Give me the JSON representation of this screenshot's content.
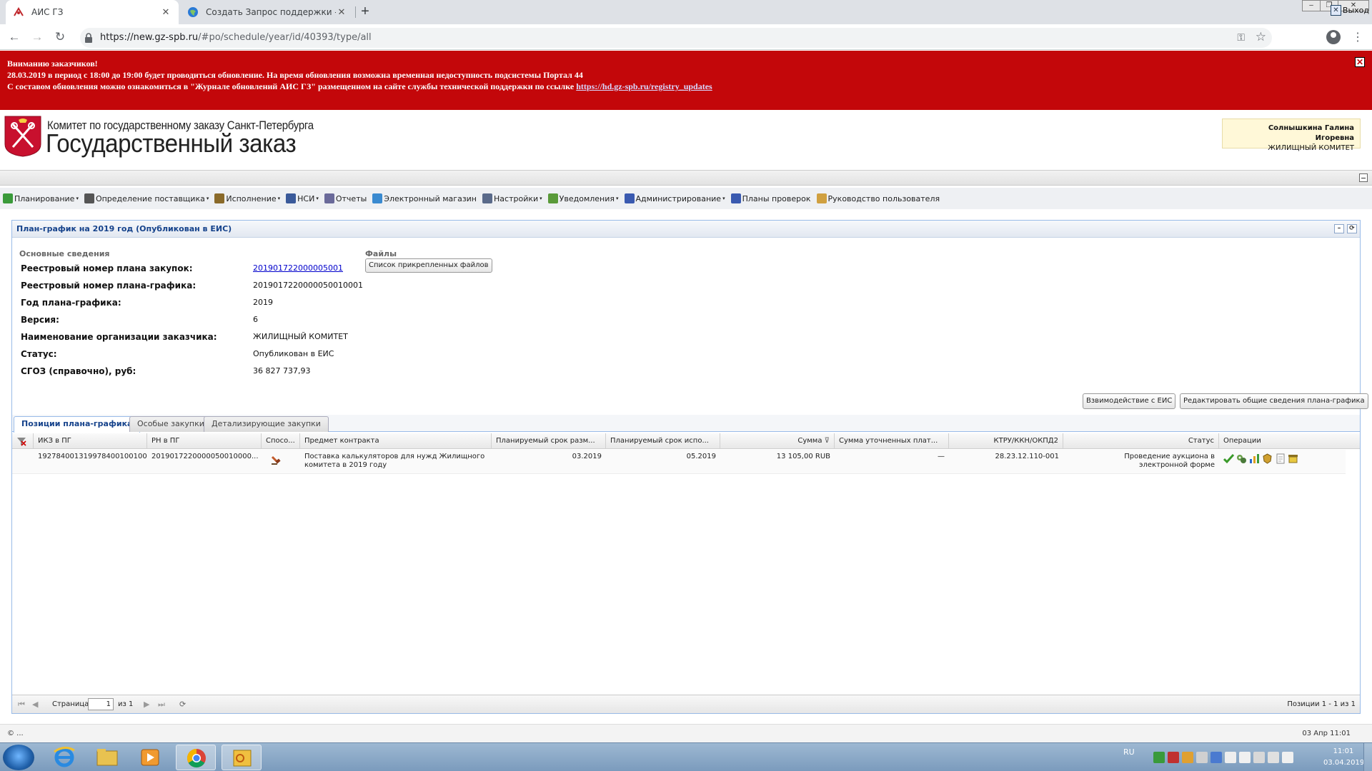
{
  "browser": {
    "tabs": [
      {
        "title": "АИС ГЗ",
        "icon": "gz-tab-icon"
      },
      {
        "title": "Создать Запрос поддержки - АИС",
        "icon": "globe-icon"
      }
    ],
    "url_host": "https://new.gz-spb.ru",
    "url_path": "/#po/schedule/year/id/40393/type/all"
  },
  "alert": {
    "line1": "Вниманию заказчиков!",
    "line2": "28.03.2019 в период с 18:00 до 19:00 будет проводиться обновление. На время обновления возможна временная недоступность подсистемы Портал 44",
    "line3": "С составом обновления можно ознакомиться в \"Журнале обновлений АИС ГЗ\" размещенном на сайте службы технической поддержки по ссылке",
    "link": "https://hd.gz-spb.ru/registry_updates"
  },
  "header": {
    "org": "Комитет по государственному заказу Санкт-Петербурга",
    "title": "Государственный заказ",
    "user_name": "Солнышкина Галина Игоревна",
    "user_org": "ЖИЛИЩНЫЙ КОМИТЕТ"
  },
  "menu": [
    {
      "label": "Планирование",
      "caret": "▾",
      "color": "#3a9a3a"
    },
    {
      "label": "Определение поставщика",
      "caret": "▾",
      "color": "#555555"
    },
    {
      "label": "Исполнение",
      "caret": "▾",
      "color": "#8a6a2a"
    },
    {
      "label": "НСИ",
      "caret": "▾",
      "color": "#3a5a9a"
    },
    {
      "label": "Отчеты",
      "caret": "",
      "color": "#6a6a9a"
    },
    {
      "label": "Электронный магазин",
      "caret": "",
      "color": "#3a8ad0"
    },
    {
      "label": "Настройки",
      "caret": "▾",
      "color": "#5a6a8a"
    },
    {
      "label": "Уведомления",
      "caret": "▾",
      "color": "#5a9a3a"
    },
    {
      "label": "Администрирование",
      "caret": "▾",
      "color": "#3a5ab0"
    },
    {
      "label": "Планы проверок",
      "caret": "",
      "color": "#3a5ab0"
    },
    {
      "label": "Руководство пользователя",
      "caret": "",
      "color": "#d0a040"
    }
  ],
  "exit_label": "Выход",
  "panel": {
    "title": "План-график на 2019 год (Опубликован в ЕИС)",
    "section": "Основные сведения",
    "files_label": "Файлы",
    "files_button": "Список прикрепленных файлов",
    "fields": [
      {
        "key": "Реестровый номер плана закупок:",
        "value": "201901722000005001",
        "link": true
      },
      {
        "key": "Реестровый номер плана-графика:",
        "value": "2019017220000050010001",
        "link": false
      },
      {
        "key": "Год плана-графика:",
        "value": "2019",
        "link": false
      },
      {
        "key": "Версия:",
        "value": "6",
        "link": false
      },
      {
        "key": "Наименование организации заказчика:",
        "value": "ЖИЛИЩНЫЙ КОМИТЕТ",
        "link": false
      },
      {
        "key": "Статус:",
        "value": "Опубликован в ЕИС",
        "link": false
      },
      {
        "key": "СГОЗ (справочно), руб:",
        "value": "36 827 737,93",
        "link": false
      }
    ],
    "btn_eis": "Взвимодействие с ЕИС",
    "btn_edit": "Редактировать общие сведения плана-графика",
    "tabs": [
      "Позиции плана-графика",
      "Особые закупки",
      "Детализирующие закупки"
    ]
  },
  "grid": {
    "columns": [
      "ИКЗ в ПГ",
      "РН в ПГ",
      "Спосо...",
      "Предмет контракта",
      "Планируемый срок разм...",
      "Планируемый срок испо...",
      "Сумма",
      "Сумма уточненных плат...",
      "КТРУ/ККН/ОКПД2",
      "Статус",
      "Операции"
    ],
    "rows": [
      {
        "ikz": "192784001319978400100100...",
        "rn": "2019017220000050010000...",
        "subject": "Поставка калькуляторов для нужд Жилищного комитета в 2019 году",
        "date_place": "03.2019",
        "date_exec": "05.2019",
        "sum": "13 105,00 RUB",
        "sum_refined": "—",
        "ktru": "28.23.12.110-001",
        "status": "Проведение аукциона в электронной форме"
      }
    ]
  },
  "pager": {
    "page_label": "Страница",
    "page": "1",
    "of_label": "из 1",
    "summary": "Позиции 1 - 1 из 1"
  },
  "footer": {
    "left": "© ...",
    "right": "03 Апр 11:01"
  },
  "taskbar": {
    "lang": "RU",
    "time": "11:01",
    "date": "03.04.2019"
  }
}
